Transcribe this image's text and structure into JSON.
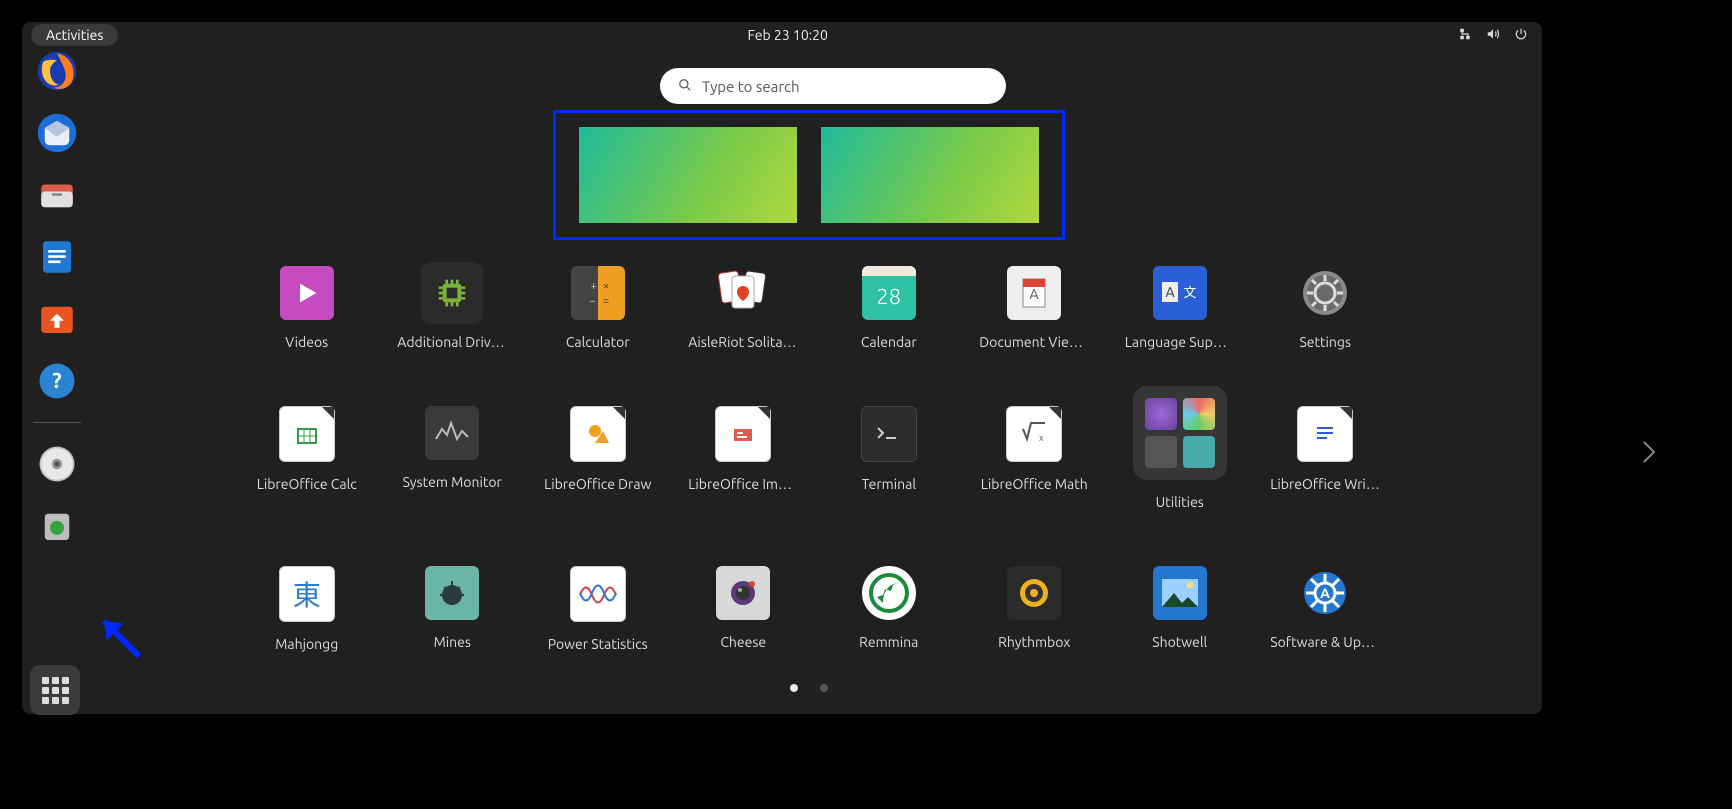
{
  "topbar": {
    "activities_label": "Activities",
    "clock": "Feb 23  10:20",
    "tray": {
      "network_icon": "network-wired-icon",
      "volume_icon": "volume-icon",
      "power_icon": "power-icon"
    }
  },
  "search": {
    "placeholder": "Type to search"
  },
  "workspaces": {
    "count": 2
  },
  "dock": {
    "items": [
      {
        "name": "firefox",
        "icon": "firefox-icon"
      },
      {
        "name": "thunderbird",
        "icon": "thunderbird-icon"
      },
      {
        "name": "files",
        "icon": "files-icon"
      },
      {
        "name": "libreoffice-writer",
        "icon": "writer-icon"
      },
      {
        "name": "ubuntu-software",
        "icon": "software-icon"
      },
      {
        "name": "help",
        "icon": "help-icon"
      },
      {
        "separator": true
      },
      {
        "name": "disc",
        "icon": "disc-icon"
      },
      {
        "name": "trash",
        "icon": "trash-icon"
      }
    ],
    "show_apps_label": "Show Applications"
  },
  "apps": [
    {
      "label": "Videos",
      "icon": "videos-icon",
      "bg": "#c64bc0"
    },
    {
      "label": "Additional Drivers",
      "icon": "chip-icon",
      "bg": "#2b2b2b"
    },
    {
      "label": "Calculator",
      "icon": "calculator-icon",
      "bg": "#3a3a3a"
    },
    {
      "label": "AisleRiot Solitaire",
      "icon": "cards-icon",
      "bg": "#ffffff"
    },
    {
      "label": "Calendar",
      "icon": "calendar-icon",
      "bg": "#2ec1a3",
      "text": "28"
    },
    {
      "label": "Document Viewer",
      "icon": "document-icon",
      "bg": "#efefef"
    },
    {
      "label": "Language Support",
      "icon": "language-icon",
      "bg": "#2a5fd8"
    },
    {
      "label": "Settings",
      "icon": "settings-icon",
      "bg": "#5a5a5a"
    },
    {
      "label": "LibreOffice Calc",
      "icon": "calc-icon",
      "bg": "#ffffff"
    },
    {
      "label": "System Monitor",
      "icon": "monitor-icon",
      "bg": "#3a3a3a"
    },
    {
      "label": "LibreOffice Draw",
      "icon": "draw-icon",
      "bg": "#ffffff"
    },
    {
      "label": "LibreOffice Impress",
      "icon": "impress-icon",
      "bg": "#ffffff"
    },
    {
      "label": "Terminal",
      "icon": "terminal-icon",
      "bg": "#2b2b2b"
    },
    {
      "label": "LibreOffice Math",
      "icon": "math-icon",
      "bg": "#ffffff"
    },
    {
      "label": "Utilities",
      "icon": "folder-utilities",
      "folder": true
    },
    {
      "label": "LibreOffice Writer",
      "icon": "writer-grid-icon",
      "bg": "#ffffff"
    },
    {
      "label": "Mahjongg",
      "icon": "mahjongg-icon",
      "bg": "#ffffff"
    },
    {
      "label": "Mines",
      "icon": "mines-icon",
      "bg": "#6bb5a5"
    },
    {
      "label": "Power Statistics",
      "icon": "power-stats-icon",
      "bg": "#ffffff"
    },
    {
      "label": "Cheese",
      "icon": "cheese-icon",
      "bg": "#d8d8d8"
    },
    {
      "label": "Remmina",
      "icon": "remmina-icon",
      "bg": "#ffffff"
    },
    {
      "label": "Rhythmbox",
      "icon": "rhythmbox-icon",
      "bg": "#2b2b2b"
    },
    {
      "label": "Shotwell",
      "icon": "shotwell-icon",
      "bg": "#2477d0"
    },
    {
      "label": "Software & Updates",
      "icon": "software-updates-icon",
      "bg": "#2477d0"
    }
  ],
  "pager": {
    "pages": 2,
    "active": 0
  }
}
